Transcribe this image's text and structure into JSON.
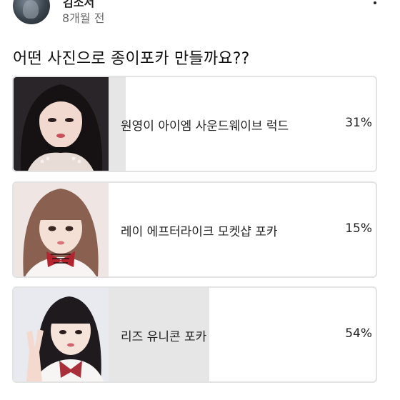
{
  "post": {
    "author": "김소서",
    "time": "8개월 전",
    "question": "어떤 사진으로 종이포카 만들까요??"
  },
  "icons": {
    "more": "more-vertical-icon",
    "avatar": "profile-photo"
  },
  "poll": {
    "options": [
      {
        "label": "원영이 아이엠 사운드웨이브 럭드",
        "percent_text": "31%",
        "percent": 31
      },
      {
        "label": "레이 에프터라이크 모켓샵 포카",
        "percent_text": "15%",
        "percent": 15
      },
      {
        "label": "리즈 유니콘 포카",
        "percent_text": "54%",
        "percent": 54
      }
    ]
  },
  "colors": {
    "bar_fill": "#e6e6e6",
    "border": "#e3e3e3",
    "text": "#222222",
    "muted": "#6b6b6b"
  }
}
